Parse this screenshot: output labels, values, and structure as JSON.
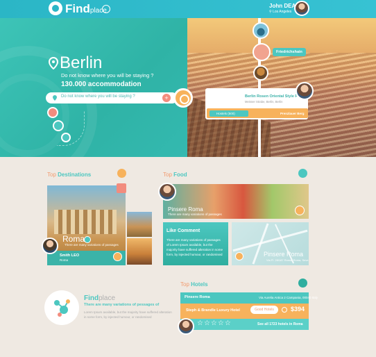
{
  "header": {
    "logo_main": "Find",
    "logo_sub": "place",
    "user_name": "John DEAD",
    "user_location": "Los Angeles"
  },
  "hero": {
    "city": "Berlin",
    "subtitle": "Do not know where you will be staying ?",
    "count": "130.000 accommodation",
    "search_placeholder": "Do not know where you will be staying ?",
    "tag": "Friedrichshain",
    "hotel_name": "Berlin Rosen Oriental Style P'Berg",
    "hotel_address": "Meisner Strabe, Berlin, Berlin",
    "hotel_tag_left": "Hostels (500)",
    "hotel_tag_right": "Prenzlauer Berg"
  },
  "destinations": {
    "title_prefix": "Top",
    "title_main": "Destinations",
    "city": "Roma",
    "desc": "There are many variations of passages",
    "user_name": "Smith LEO",
    "user_city": "Roma"
  },
  "food": {
    "title_prefix": "Top",
    "title_main": "Food",
    "name": "Pinsere Roma",
    "desc": "There are many variations of passages",
    "comment_title": "Like Comment",
    "comment_text": "There are many variations of passages of Lorem Ipsum available, but the majority have suffered alteration in some form, by injected humour, or randomised",
    "map_name": "Pinsere Roma",
    "map_address": "Via Fl. 28/187 Roma, Roma, Seve"
  },
  "about": {
    "brand_main": "Find",
    "brand_sub": "place",
    "headline": "There are many variations of pessages of",
    "text": "Lorem Ipsum available, but the majority have suffered alteration in some form, by injected humour, or randomised"
  },
  "hotels": {
    "title_prefix": "Top",
    "title_main": "Hotels",
    "row1_name": "Pinsere Roma",
    "row1_address": "Via Aurelia Antica 2 Campania, 00040 Italy",
    "row2_name": "Steph & Brandle Luxury Hotel",
    "good_label": "Good Hotels",
    "price": "$394",
    "stars": "☆☆☆☆☆",
    "see_all": "See all 1723 hotels in Roma"
  },
  "colors": {
    "accent": "#4cc7c0",
    "orange": "#f7b25c",
    "coral": "#f28c7e",
    "background": "#efe9e2"
  }
}
